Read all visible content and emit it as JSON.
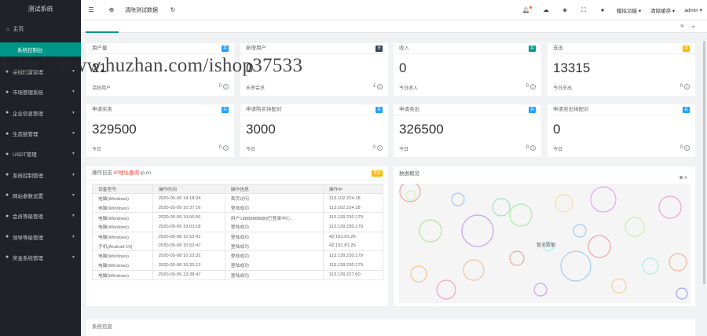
{
  "sidebar": {
    "brand": "测试系统",
    "home_label": "主页",
    "active_item": "系统控制台",
    "items": [
      {
        "label": "系统配置管理"
      },
      {
        "label": "市场管理系统"
      },
      {
        "label": "企业信息管理"
      },
      {
        "label": "生态链管理"
      },
      {
        "label": "USDT管理"
      },
      {
        "label": "系统控制管理"
      },
      {
        "label": "网站参数设置"
      },
      {
        "label": "会员等级管理"
      },
      {
        "label": "领导等级管理"
      },
      {
        "label": "奖金系统管理"
      }
    ]
  },
  "header": {
    "clear_cache": "清除测试数据",
    "user_label": "模拟功能",
    "fill_label": "清除缓存",
    "admin_label": "admin"
  },
  "stats": [
    {
      "title": "用户量",
      "badge": "共",
      "badge_color": "#1e9fff",
      "value": "21",
      "foot": "活跃用户",
      "foot_value": "0"
    },
    {
      "title": "新增用户",
      "badge": "日",
      "badge_color": "#2f4056",
      "value": "0",
      "foot": "未审会员",
      "foot_value": "1"
    },
    {
      "title": "收入",
      "badge": "共",
      "badge_color": "#009688",
      "value": "0",
      "foot": "今日收入",
      "foot_value": "0"
    },
    {
      "title": "支出",
      "badge": "共",
      "badge_color": "#ffb800",
      "value": "13315",
      "foot": "今日支出",
      "foot_value": "0"
    },
    {
      "title": "申请买卖",
      "badge": "共",
      "badge_color": "#1e9fff",
      "value": "329500",
      "foot": "今日",
      "foot_value": "0"
    },
    {
      "title": "申请购买待配对",
      "badge": "共",
      "badge_color": "#1e9fff",
      "value": "3000",
      "foot": "今日",
      "foot_value": "0"
    },
    {
      "title": "申请卖出",
      "badge": "共",
      "badge_color": "#1e9fff",
      "value": "326500",
      "foot": "今日",
      "foot_value": "0"
    },
    {
      "title": "申请卖出待配对",
      "badge": "共",
      "badge_color": "#1e9fff",
      "value": "0",
      "foot": "今日",
      "foot_value": "0"
    }
  ],
  "log": {
    "title_prefix": "操作日志",
    "title_red": "IP地址查询",
    "title_suffix": "ip.cn",
    "badge": "更多",
    "columns": [
      "设备型号",
      "操作时间",
      "操作信息",
      "操作IP"
    ],
    "rows": [
      [
        "电脑(Windows)",
        "2020-05-09 14:18:24",
        "首页访问",
        "113.102.224.18"
      ],
      [
        "电脑(Windows)",
        "2020-05-09 10:37:16",
        "登陆成功",
        "113.102.224.18"
      ],
      [
        "电脑(Windows)",
        "2020-05-09 19:56:56",
        "用户18888888888已登录中心",
        "113.139.230.179"
      ],
      [
        "电脑(Windows)",
        "2020-05-09 19:03:18",
        "登陆成功",
        "113.139.230.179"
      ],
      [
        "电脑(Windows)",
        "2020-05-08 15:53:41",
        "登陆成功",
        "42.191.81.26"
      ],
      [
        "手机(Android 10)",
        "2020-05-08 15:52:47",
        "登陆成功",
        "42.191.81.26"
      ],
      [
        "电脑(Windows)",
        "2020-05-08 10:23:32",
        "登陆成功",
        "113.139.230.179"
      ],
      [
        "电脑(Windows)",
        "2020-05-08 10:20:13",
        "登陆成功",
        "113.139.230.179"
      ],
      [
        "电脑(Windows)",
        "2020-05-06 13:38:47",
        "登陆成功",
        "113.139.227.60"
      ]
    ]
  },
  "overview": {
    "title": "数据概览",
    "center_label": "暂无数据"
  },
  "sysinfo": {
    "title": "系统信息"
  },
  "watermark": "https://www.huzhan.com/ishop37533"
}
